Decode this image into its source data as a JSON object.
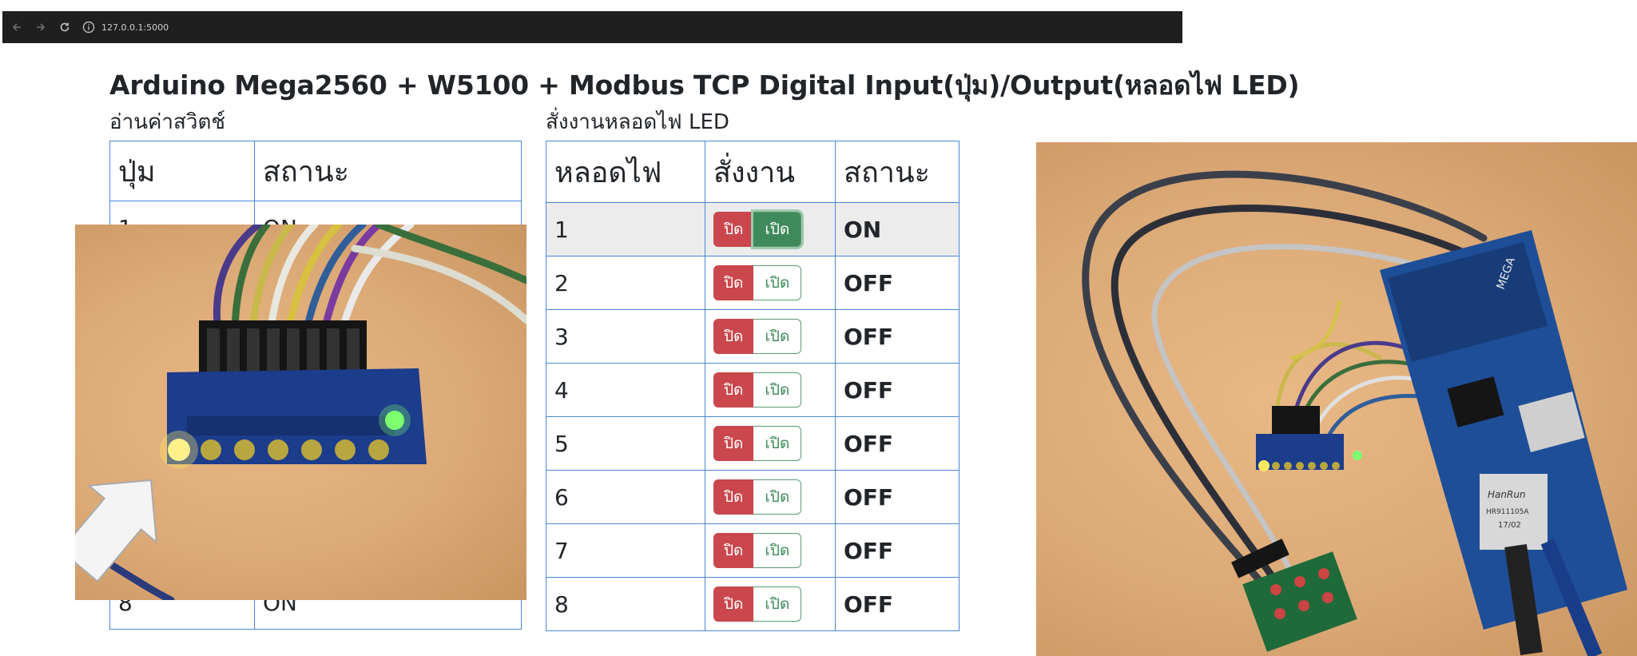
{
  "browser": {
    "url": "127.0.0.1:5000"
  },
  "page": {
    "title": "Arduino Mega2560 + W5100 + Modbus TCP Digital Input(ปุ่ม)/Output(หลอดไฟ LED)"
  },
  "switch_section": {
    "heading": "อ่านค่าสวิตช์",
    "columns": [
      "ปุ่ม",
      "สถานะ"
    ],
    "rows": [
      {
        "button": "1",
        "state": "ON"
      },
      {
        "button": "8",
        "state": "ON"
      }
    ]
  },
  "led_section": {
    "heading": "สั่งงานหลอดไฟ LED",
    "columns": [
      "หลอดไฟ",
      "สั่งงาน",
      "สถานะ"
    ],
    "off_label": "ปิด",
    "on_label": "เปิด",
    "rows": [
      {
        "lamp": "1",
        "state": "ON"
      },
      {
        "lamp": "2",
        "state": "OFF"
      },
      {
        "lamp": "3",
        "state": "OFF"
      },
      {
        "lamp": "4",
        "state": "OFF"
      },
      {
        "lamp": "5",
        "state": "OFF"
      },
      {
        "lamp": "6",
        "state": "OFF"
      },
      {
        "lamp": "7",
        "state": "OFF"
      },
      {
        "lamp": "8",
        "state": "OFF"
      }
    ]
  },
  "board_labels": {
    "mega": "MEGA",
    "hanrun": "HanRun",
    "hanrun_model": "HR911105A",
    "hanrun_date": "17/02"
  }
}
